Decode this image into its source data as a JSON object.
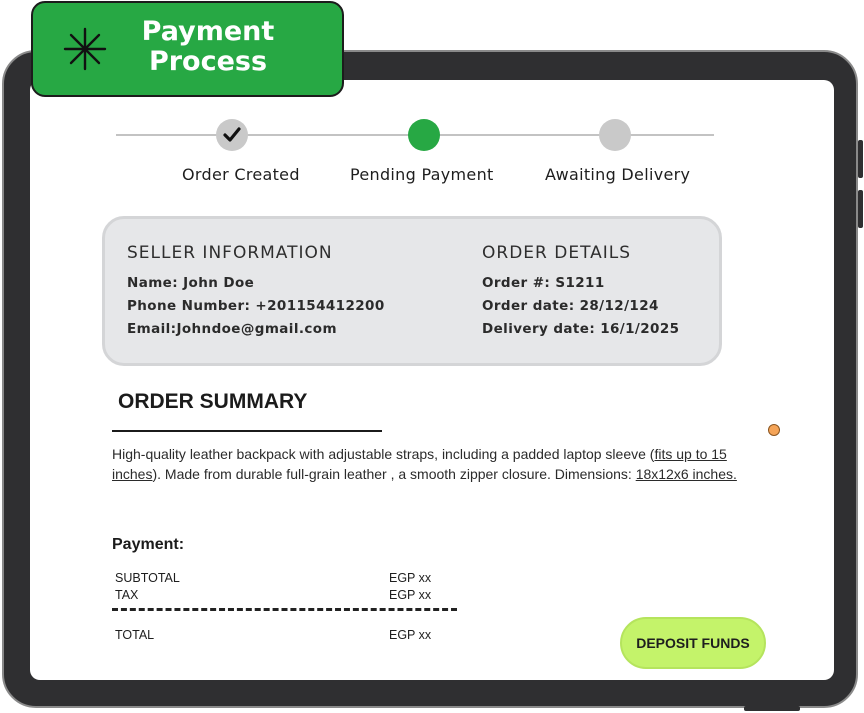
{
  "badge": {
    "title": "Payment\nProcess",
    "icon": "asterisk-icon"
  },
  "steps": [
    {
      "label": "Order Created",
      "state": "done",
      "color": "#c9c9c9"
    },
    {
      "label": "Pending Payment",
      "state": "current",
      "color": "#27a844"
    },
    {
      "label": "Awaiting Delivery",
      "state": "upcoming",
      "color": "#c9c9c9"
    }
  ],
  "seller": {
    "heading": "SELLER INFORMATION",
    "name": "Name: John Doe",
    "phone": "Phone Number: +201154412200",
    "email": "Email:Johndoe@gmail.com"
  },
  "order": {
    "heading": "ORDER DETAILS",
    "number": "Order #: S1211",
    "date": "Order date: 28/12/124",
    "delivery": "Delivery date: 16/1/2025"
  },
  "summary": {
    "title": "ORDER SUMMARY",
    "desc_a": "High-quality leather backpack with adjustable straps,  including a padded laptop sleeve (",
    "desc_link1": "fits up to 15 inches",
    "desc_b": "). Made from durable full-grain leather ,  a smooth zipper closure. Dimensions: ",
    "desc_link2": "18x12x6 inches."
  },
  "payment": {
    "title": "Payment:",
    "subtotal_label": "SUBTOTAL",
    "subtotal_value": "EGP xx",
    "tax_label": "TAX",
    "tax_value": "EGP xx",
    "total_label": "TOTAL",
    "total_value": "EGP xx"
  },
  "deposit_button": "DEPOSIT FUNDS",
  "colors": {
    "accent": "#27a844",
    "button": "#c4f36a",
    "card": "#e6e7e9",
    "frame": "#2f2f31"
  }
}
